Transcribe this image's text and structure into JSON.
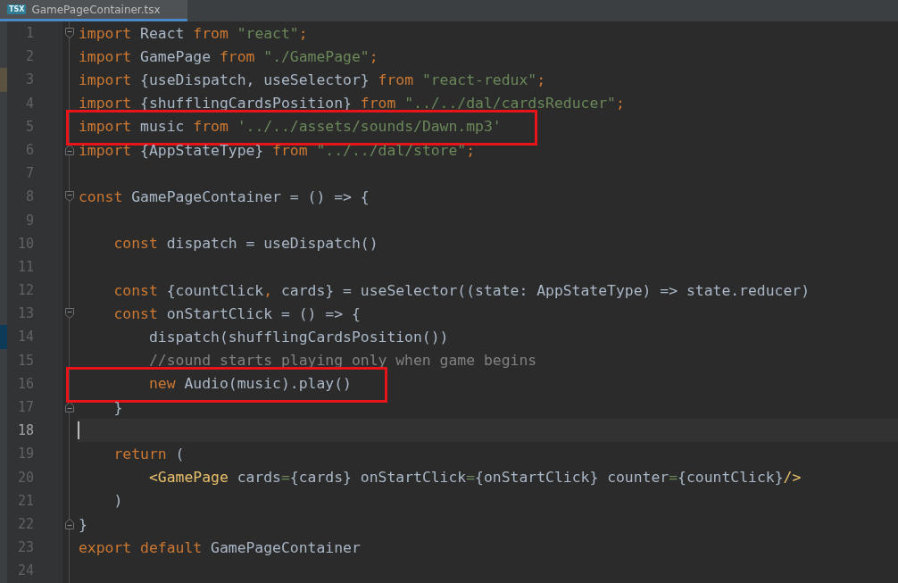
{
  "tab": {
    "file_type": "TSX",
    "label": "GamePageContainer.tsx",
    "selected": true
  },
  "lines": [
    {
      "number": "1",
      "fold_start": true,
      "tokens": [
        {
          "kind": "keyword",
          "text": "import"
        },
        {
          "kind": "plain",
          "text": " React "
        },
        {
          "kind": "keyword",
          "text": "from"
        },
        {
          "kind": "string",
          "text": " \"react\""
        },
        {
          "kind": "keyword",
          "text": ";"
        }
      ]
    },
    {
      "number": "2",
      "tokens": [
        {
          "kind": "keyword",
          "text": "import"
        },
        {
          "kind": "plain",
          "text": " GamePage "
        },
        {
          "kind": "keyword",
          "text": "from"
        },
        {
          "kind": "string",
          "text": " \"./GamePage\""
        },
        {
          "kind": "keyword",
          "text": ";"
        }
      ]
    },
    {
      "number": "3",
      "color": "#5b5340",
      "tokens": [
        {
          "kind": "keyword",
          "text": "import"
        },
        {
          "kind": "plain",
          "text": " {useDispatch, useSelector} "
        },
        {
          "kind": "keyword",
          "text": "from"
        },
        {
          "kind": "string",
          "text": " \"react-redux\""
        },
        {
          "kind": "keyword",
          "text": ";"
        }
      ]
    },
    {
      "number": "4",
      "tokens": [
        {
          "kind": "keyword",
          "text": "import"
        },
        {
          "kind": "plain",
          "text": " {shufflingCardsPosition} "
        },
        {
          "kind": "keyword",
          "text": "from"
        },
        {
          "kind": "string",
          "text": " \"../../dal/cardsReducer\""
        },
        {
          "kind": "keyword",
          "text": ";"
        }
      ]
    },
    {
      "number": "5",
      "boxed": true,
      "tokens": [
        {
          "kind": "keyword",
          "text": "import"
        },
        {
          "kind": "plain",
          "text": " music "
        },
        {
          "kind": "keyword",
          "text": "from"
        },
        {
          "kind": "string",
          "text": " '../../assets/sounds/Dawn.mp3'"
        }
      ]
    },
    {
      "number": "6",
      "fold_end": true,
      "tokens": [
        {
          "kind": "keyword",
          "text": "import"
        },
        {
          "kind": "plain",
          "text": " {AppStateType} "
        },
        {
          "kind": "keyword",
          "text": "from"
        },
        {
          "kind": "string",
          "text": " \"../../dal/store\""
        },
        {
          "kind": "keyword",
          "text": ";"
        }
      ]
    },
    {
      "number": "7"
    },
    {
      "number": "8",
      "fold_start": true,
      "tokens": [
        {
          "kind": "keyword",
          "text": "const"
        },
        {
          "kind": "plain",
          "text": " GamePageContainer = () => {"
        }
      ]
    },
    {
      "number": "9"
    },
    {
      "number": "10",
      "tokens": [
        {
          "kind": "keyword",
          "text": "    const"
        },
        {
          "kind": "plain",
          "text": " dispatch = useDispatch()"
        }
      ]
    },
    {
      "number": "11"
    },
    {
      "number": "12",
      "tokens": [
        {
          "kind": "keyword",
          "text": "    const"
        },
        {
          "kind": "plain",
          "text": " {countClick"
        },
        {
          "kind": "keyword",
          "text": ","
        },
        {
          "kind": "plain",
          "text": " cards} = useSelector((state: AppStateType) => state.reducer)"
        }
      ]
    },
    {
      "number": "13",
      "fold_start": true,
      "tokens": [
        {
          "kind": "keyword",
          "text": "    const"
        },
        {
          "kind": "plain",
          "text": " onStartClick = () => {"
        }
      ]
    },
    {
      "number": "14",
      "color": "#0d3a58",
      "tokens": [
        {
          "kind": "plain",
          "text": "        dispatch(shufflingCardsPosition())"
        }
      ]
    },
    {
      "number": "15",
      "tokens": [
        {
          "kind": "comment",
          "text": "        //sound starts playing only when game begins"
        }
      ]
    },
    {
      "number": "16",
      "boxed": true,
      "tokens": [
        {
          "kind": "keyword",
          "text": "        new"
        },
        {
          "kind": "plain",
          "text": " Audio(music).play()"
        }
      ]
    },
    {
      "number": "17",
      "fold_end": true,
      "tokens": [
        {
          "kind": "plain",
          "text": "    }"
        }
      ]
    },
    {
      "number": "18",
      "current": true
    },
    {
      "number": "19",
      "tokens": [
        {
          "kind": "keyword",
          "text": "    return"
        },
        {
          "kind": "plain",
          "text": " ("
        }
      ]
    },
    {
      "number": "20",
      "tokens": [
        {
          "kind": "tag",
          "text": "        <GamePage"
        },
        {
          "kind": "plain",
          "text": " cards"
        },
        {
          "kind": "equals",
          "text": "="
        },
        {
          "kind": "plain",
          "text": "{cards} onStartClick"
        },
        {
          "kind": "equals",
          "text": "="
        },
        {
          "kind": "plain",
          "text": "{onStartClick} counter"
        },
        {
          "kind": "equals",
          "text": "="
        },
        {
          "kind": "plain",
          "text": "{countClick}"
        },
        {
          "kind": "tag",
          "text": "/>"
        }
      ]
    },
    {
      "number": "21",
      "tokens": [
        {
          "kind": "plain",
          "text": "    )"
        }
      ]
    },
    {
      "number": "22",
      "fold_end": true,
      "tokens": [
        {
          "kind": "plain",
          "text": "}"
        }
      ]
    },
    {
      "number": "23",
      "tokens": [
        {
          "kind": "keyword",
          "text": "export default"
        },
        {
          "kind": "plain",
          "text": " GamePageContainer"
        }
      ]
    },
    {
      "number": "24"
    }
  ]
}
